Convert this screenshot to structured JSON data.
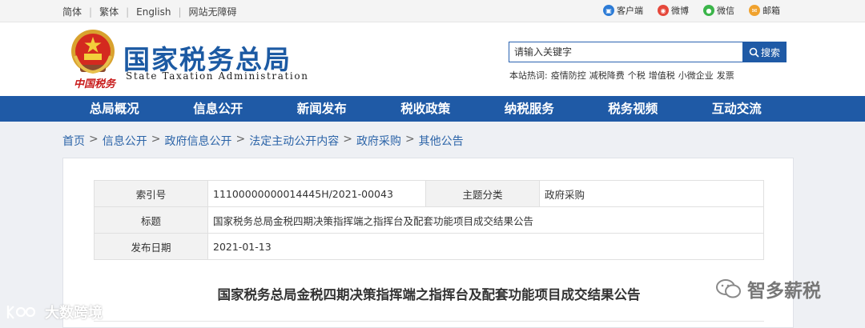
{
  "topbar": {
    "links": [
      "简体",
      "繁体",
      "English",
      "网站无障碍"
    ],
    "social": [
      {
        "label": "客户端",
        "icon": "mobile-icon",
        "color": "#2c7bd6"
      },
      {
        "label": "微博",
        "icon": "weibo-icon",
        "color": "#e5483b"
      },
      {
        "label": "微信",
        "icon": "wechat-icon",
        "color": "#3bb54a"
      },
      {
        "label": "邮箱",
        "icon": "mail-icon",
        "color": "#f0a22e"
      }
    ]
  },
  "header": {
    "title": "国家税务总局",
    "subtitle": "State Taxation Administration",
    "seal_text": "中国税务",
    "search_placeholder": "请输入关键字",
    "search_button": "搜索",
    "hot_label": "本站热词:",
    "hot_words": [
      "疫情防控",
      "减税降费",
      "个税",
      "增值税",
      "小微企业",
      "发票"
    ]
  },
  "nav": [
    "总局概况",
    "信息公开",
    "新闻发布",
    "税收政策",
    "纳税服务",
    "税务视频",
    "互动交流"
  ],
  "breadcrumb": [
    "首页",
    "信息公开",
    "政府信息公开",
    "法定主动公开内容",
    "政府采购",
    "其他公告"
  ],
  "meta": {
    "index_label": "索引号",
    "index_value": "11100000000014445H/2021-00043",
    "topic_label": "主题分类",
    "topic_value": "政府采购",
    "title_label": "标题",
    "title_value": "国家税务总局金税四期决策指挥端之指挥台及配套功能项目成交结果公告",
    "date_label": "发布日期",
    "date_value": "2021-01-13"
  },
  "article_title": "国家税务总局金税四期决策指挥端之指挥台及配套功能项目成交结果公告",
  "watermarks": {
    "right": "智多薪税",
    "left": "大数跨境"
  },
  "colors": {
    "brand_blue": "#1f5aa6",
    "title_blue": "#1c5aa3",
    "seal_red": "#c81b1b"
  }
}
